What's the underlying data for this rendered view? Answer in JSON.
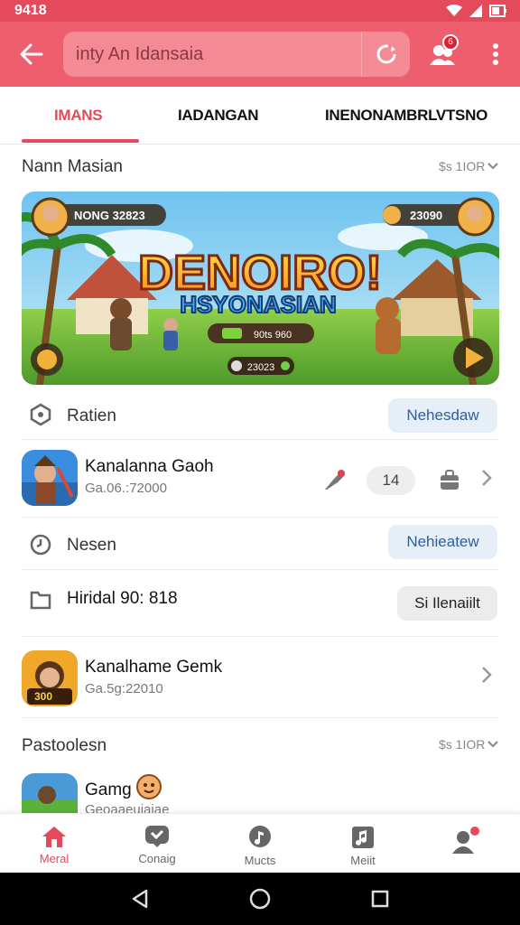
{
  "status_bar": {
    "time": "9418"
  },
  "app_bar": {
    "search_placeholder": "inty An Idansaia",
    "notification_count": "6"
  },
  "tabs": [
    {
      "label": "IMANS",
      "active": true
    },
    {
      "label": "IADANGAN",
      "active": false
    },
    {
      "label": "INENONAMBRLVTSNO",
      "active": false
    }
  ],
  "section1": {
    "title": "Nann Masian",
    "meta": "$s 1IOR"
  },
  "banner": {
    "title": "DENOIRO!",
    "subtitle": "HSYONASIAN",
    "score_left": "NONG 32823",
    "score_right": "23090",
    "button_text": "90ts 960",
    "coins": "23023"
  },
  "rows": {
    "ratien": {
      "label": "Ratien",
      "button": "Nehesdaw"
    },
    "game1": {
      "name": "Kanalanna Gaoh",
      "sub": "Ga.06.:72000",
      "count": "14"
    },
    "nesen": {
      "label": "Nesen",
      "button": "Nehieatew"
    },
    "hiridal": {
      "label": "Hiridal 90: 818",
      "button": "Si Ilenaiilt"
    },
    "game2": {
      "name": "Kanalhame Gemk",
      "sub": "Ga.5g:22010",
      "badge": "300"
    }
  },
  "section2": {
    "title": "Pastoolesn",
    "meta": "$s 1IOR"
  },
  "partial_item": {
    "name": "Gamg",
    "sub": "Geoaaeuiaiae"
  },
  "bottom_nav": [
    {
      "label": "Meral",
      "icon": "home-icon",
      "active": true
    },
    {
      "label": "Conaig",
      "icon": "chat-icon",
      "active": false
    },
    {
      "label": "Mucts",
      "icon": "music-icon",
      "active": false
    },
    {
      "label": "Meiit",
      "icon": "library-icon",
      "active": false
    },
    {
      "label": "",
      "icon": "profile-icon",
      "active": false
    }
  ],
  "colors": {
    "accent": "#e4495c",
    "app_bar": "#ee5e6f",
    "button_blue": "#2f5f9a"
  }
}
